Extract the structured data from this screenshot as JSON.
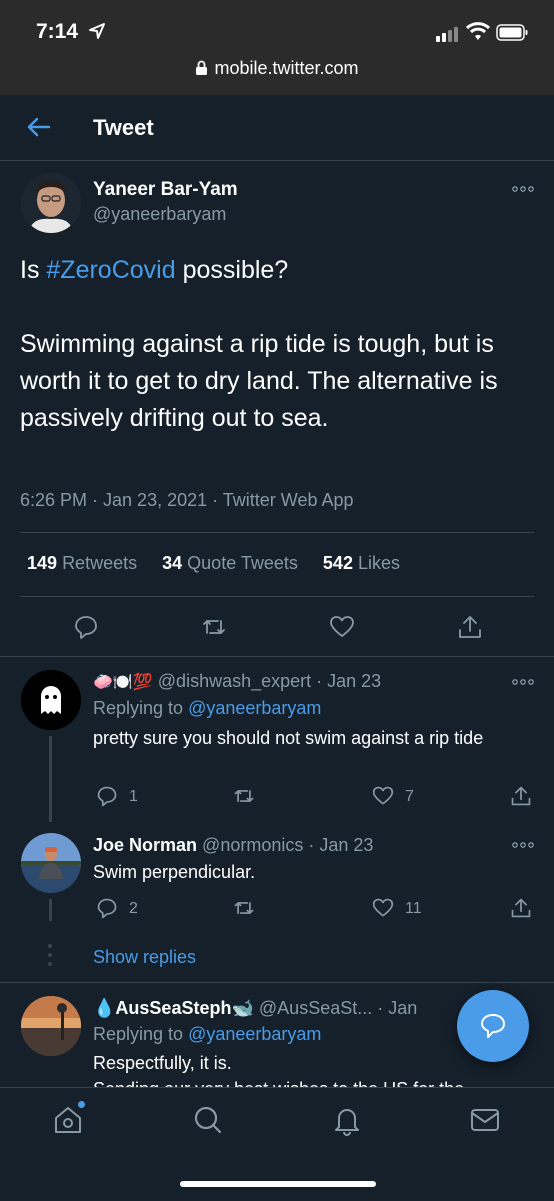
{
  "status_bar": {
    "time": "7:14",
    "url": "mobile.twitter.com"
  },
  "header": {
    "title": "Tweet"
  },
  "tweet": {
    "author_name": "Yaneer Bar-Yam",
    "author_handle": "@yaneerbaryam",
    "text_prefix": "Is ",
    "hashtag": "#ZeroCovid",
    "text_suffix": " possible?",
    "body": "Swimming against a rip tide is tough, but is worth it to get to dry land. The alternative is passively drifting out to sea.",
    "meta": "6:26 PM · Jan 23, 2021 · Twitter Web App",
    "stats": {
      "retweets_count": "149",
      "retweets_label": "Retweets",
      "quotes_count": "34",
      "quotes_label": "Quote Tweets",
      "likes_count": "542",
      "likes_label": "Likes"
    }
  },
  "replies": [
    {
      "emoji_name": "🧼🍽️💯",
      "handle": "@dishwash_expert",
      "date": " · Jan 23",
      "replying_label": "Replying to ",
      "replying_to": "@yaneerbaryam",
      "text": "pretty sure you should not swim against a rip tide",
      "reply_count": "1",
      "retweet_count": "",
      "like_count": "7"
    },
    {
      "name": "Joe Norman",
      "handle": "@normonics",
      "date": " · Jan 23",
      "text": "Swim perpendicular.",
      "reply_count": "2",
      "retweet_count": "",
      "like_count": "11"
    },
    {
      "name": "AusSeaSteph",
      "handle": "@AusSeaSt...",
      "date": " · Jan",
      "replying_label": "Replying to ",
      "replying_to": "@yaneerbaryam",
      "text": "Respectfully, it is.",
      "text_cut": "Sending our very best wishes to the US for the"
    }
  ],
  "show_replies": "Show replies",
  "colors": {
    "background": "#15202b",
    "accent": "#4a9ce8",
    "muted": "#8899a6",
    "divider": "#38444d"
  }
}
